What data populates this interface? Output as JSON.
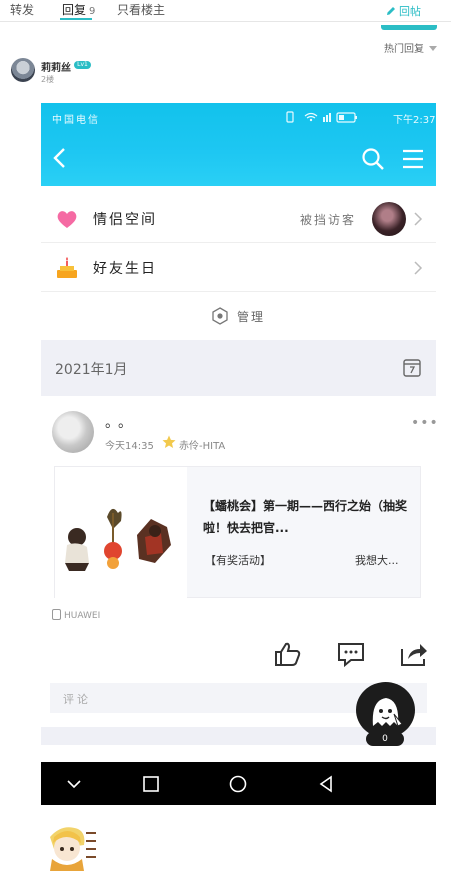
{
  "tabs": [
    {
      "label": "转发"
    },
    {
      "label": "回复",
      "count": "9"
    },
    {
      "label": "只看楼主"
    }
  ],
  "reply_button": "回帖",
  "sort_label": "热门回复",
  "poster": {
    "name": "莉莉丝",
    "level": "Lv1",
    "floor": "2楼"
  },
  "screenshot": {
    "status": {
      "carrier": "中国电信",
      "time": "下午2:37"
    },
    "rows": [
      {
        "label": "情侣空间",
        "right": "被挡访客"
      },
      {
        "label": "好友生日",
        "right": ""
      }
    ],
    "manage": "管理",
    "month": "2021年1月",
    "post": {
      "name": "。。",
      "time": "今天14:35",
      "signature": "赤伶-HITA",
      "card_title": "【蟠桃会】第一期——西行之始（抽奖啦！快去把官...",
      "card_tag": "【有奖活动】",
      "card_more": "我想大..."
    },
    "device": "HUAWEI",
    "comment_placeholder": "评论"
  },
  "float_count": "0",
  "colors": {
    "accent": "#2bbdc5",
    "header_blue": "#1ec7f2"
  }
}
